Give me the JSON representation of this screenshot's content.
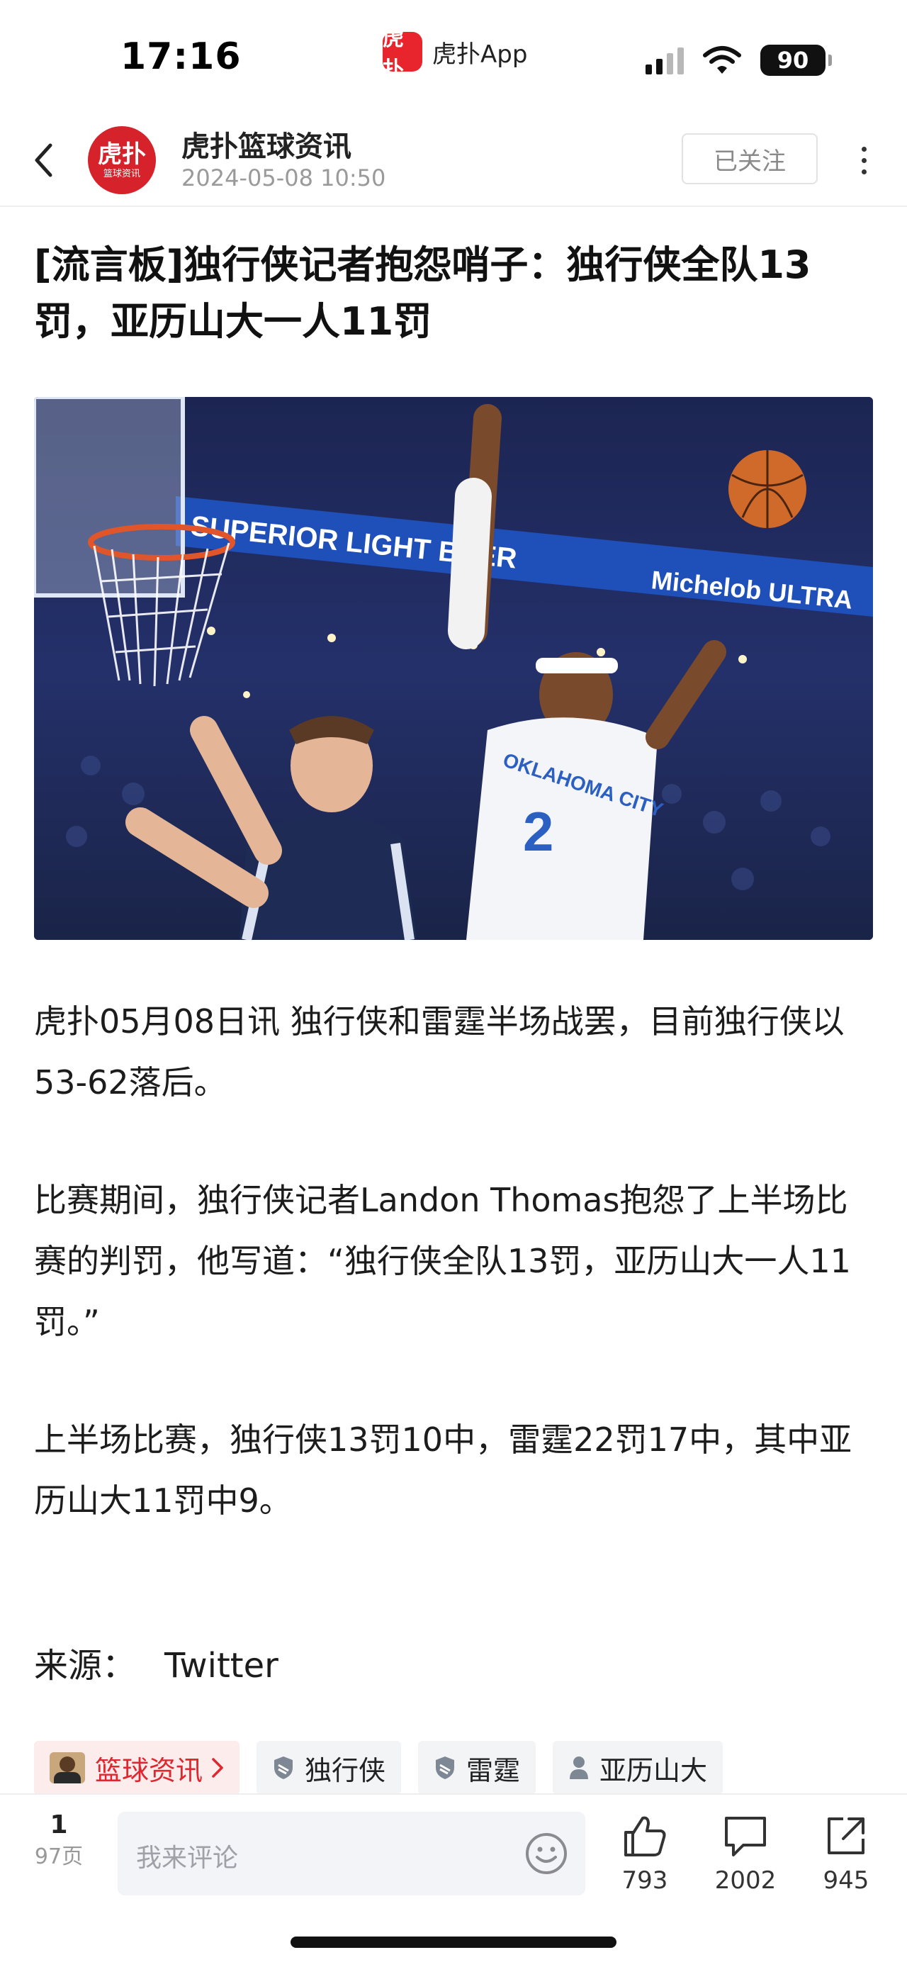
{
  "status_bar": {
    "time": "17:16",
    "back_app_logo": "虎扑",
    "back_app_label": "虎扑App",
    "battery": "90",
    "icons": [
      "cellular-signal-icon",
      "wifi-icon",
      "battery-icon"
    ]
  },
  "nav": {
    "avatar_text": "虎扑",
    "avatar_subtext": "篮球资讯",
    "author_name": "虎扑篮球资讯",
    "post_time": "2024-05-08 10:50",
    "follow_label": "已关注"
  },
  "article": {
    "title": "[流言板]独行侠记者抱怨哨子：独行侠全队13罚，亚历山大一人11罚",
    "image_ad_text_1": "SUPERIOR LIGHT BEER",
    "image_ad_text_2": "Michelob ULTRA",
    "image_jersey_text": "OKLAHOMA CITY",
    "image_jersey_number": "2",
    "paragraphs": [
      "虎扑05月08日讯 独行侠和雷霆半场战罢，目前独行侠以53-62落后。",
      "比赛期间，独行侠记者Landon Thomas抱怨了上半场比赛的判罚，他写道：“独行侠全队13罚，亚历山大一人11罚。”",
      "上半场比赛，独行侠13罚10中，雷霆22罚17中，其中亚历山大11罚中9。"
    ],
    "source_label": "来源：",
    "source_value": "Twitter"
  },
  "tags": [
    {
      "label": "篮球资讯",
      "kind": "topic"
    },
    {
      "label": "独行侠",
      "kind": "team"
    },
    {
      "label": "雷霆",
      "kind": "team"
    },
    {
      "label": "亚历山大",
      "kind": "player"
    }
  ],
  "bottom_bar": {
    "page_current": "1",
    "page_total": "97页",
    "comment_placeholder": "我来评论",
    "like_count": "793",
    "comment_count": "2002",
    "share_count": "945"
  },
  "colors": {
    "brand_red": "#e0262e",
    "muted_text": "#9a9a9a",
    "tag_bg": "#f3f4f6"
  }
}
